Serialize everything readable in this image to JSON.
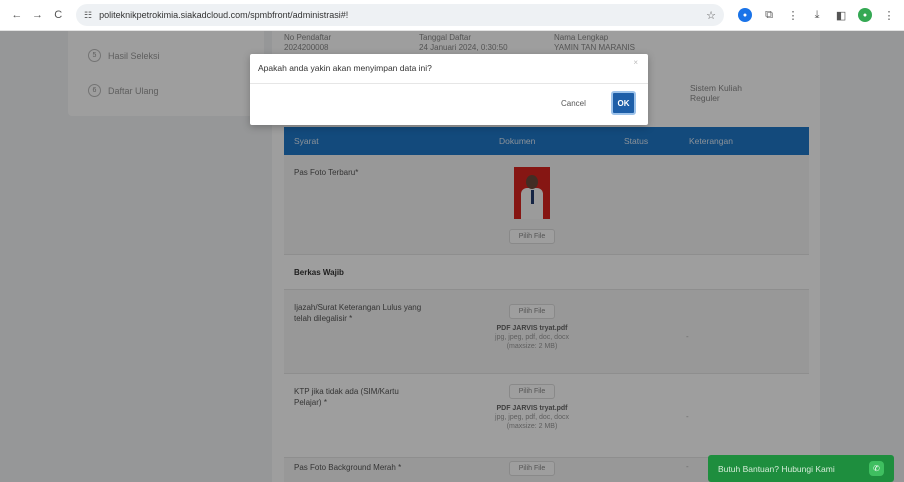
{
  "browser": {
    "url": "politeknikpetrokimia.siakadcloud.com/spmbfront/administrasi#!",
    "back_icon": "←",
    "forward_icon": "→",
    "reload_icon": "C",
    "site_info_icon": "☷",
    "star_icon": "☆"
  },
  "sidebar": {
    "steps": [
      {
        "num": "5",
        "label": "Hasil Seleksi"
      },
      {
        "num": "6",
        "label": "Daftar Ulang"
      }
    ]
  },
  "info": {
    "col1_label": "No Pendaftar",
    "col1_value": "2024200008",
    "col2_label": "Tanggal Daftar",
    "col2_value": "24 Januari 2024, 0:30:50",
    "col3_label": "Nama Lengkap",
    "col3_value": "YAMIN TAN MARANIS",
    "side_label": "Sistem Kuliah",
    "side_value": "Reguler"
  },
  "table": {
    "headers": [
      "Syarat",
      "Dokumen",
      "Status",
      "Keterangan"
    ]
  },
  "rows": {
    "photo_label": "Pas Foto Terbaru",
    "section_label": "Berkas Wajib",
    "ijazah_label": "Ijazah/Surat Keterangan Lulus yang telah dilegalisir",
    "ktp_label": "KTP jika tidak ada (SIM/Kartu Pelajar)",
    "red_photo_label": "Pas Foto Background Merah",
    "required_mark": "*",
    "file_button": "Pilih File",
    "file_name": "PDF JARVIS tryat.pdf",
    "file_types": "jpg, jpeg, pdf, doc, docx",
    "file_max": "(maxsize: 2 MB)",
    "dash": "-"
  },
  "modal": {
    "message": "Apakah anda yakin akan menyimpan data ini?",
    "close": "×",
    "cancel": "Cancel",
    "ok": "OK"
  },
  "help": {
    "label": "Butuh Bantuan? Hubungi Kami"
  }
}
